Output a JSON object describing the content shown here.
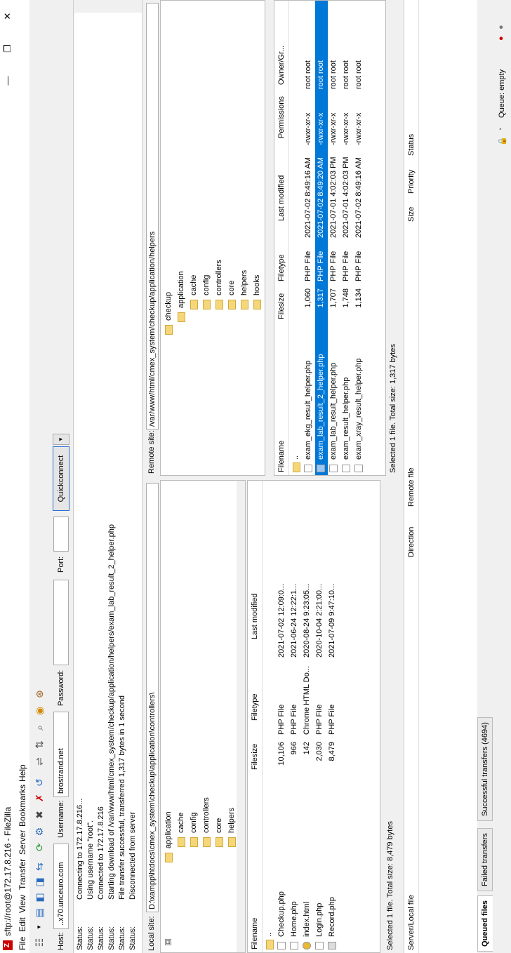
{
  "window": {
    "title": "sftp://root@172.17.8.216 - FileZilla",
    "minimize": "—",
    "maximize": "❐",
    "close": "✕"
  },
  "menu": [
    "File",
    "Edit",
    "View",
    "Transfer",
    "Server",
    "Bookmarks",
    "Help"
  ],
  "quickconnect": {
    "host_label": "Host:",
    "host_value": "..x70.unceuro.com",
    "username_label": "Username:",
    "username_value": "brostrand.net",
    "password_label": "Password:",
    "password_value": "",
    "port_label": "Port:",
    "port_value": "",
    "button": "Quickconnect",
    "dropdown": "▼"
  },
  "log": [
    {
      "k": "Status:",
      "v": "Connecting to 172.17.8.216..."
    },
    {
      "k": "Status:",
      "v": "Using username \"root\"."
    },
    {
      "k": "Status:",
      "v": "Connected to 172.17.8.216"
    },
    {
      "k": "Status:",
      "v": "Starting download of /var/www/html/cmex_system/checkup/application/helpers/exam_lab_result_2_helper.php"
    },
    {
      "k": "Status:",
      "v": "File transfer successful, transferred 1,317 bytes in 1 second"
    },
    {
      "k": "Status:",
      "v": "Disconnected from server"
    }
  ],
  "local": {
    "site_label": "Local site:",
    "path": "D:\\xampp\\htdocs\\cmex_system\\checkup\\application\\controllers\\",
    "tree": [
      "application",
      "cache",
      "config",
      "controllers",
      "core",
      "helpers"
    ],
    "headers": {
      "name": "Filename",
      "size": "Filesize",
      "type": "Filetype",
      "modified": "Last modified"
    },
    "parent": "..",
    "files": [
      {
        "name": "Checkup.php",
        "size": "10,106",
        "type": "PHP File",
        "modified": "2021-07-02 12:09:0..."
      },
      {
        "name": "Home.php",
        "size": "966",
        "type": "PHP File",
        "modified": "2021-06-24 12:22:1..."
      },
      {
        "name": "index.html",
        "size": "142",
        "type": "Chrome HTML Do...",
        "modified": "2020-08-24 9:23:05..."
      },
      {
        "name": "Login.php",
        "size": "2,030",
        "type": "PHP File",
        "modified": "2020-10-04 2:21:00..."
      },
      {
        "name": "Record.php",
        "size": "8,479",
        "type": "PHP File",
        "modified": "2021-07-09 9:47:10..."
      }
    ],
    "status": "Selected 1 file. Total size: 8,479 bytes"
  },
  "remote": {
    "site_label": "Remote site:",
    "path": "/var/www/html/cmex_system/checkup/application/helpers",
    "tree": [
      "checkup",
      "application",
      "cache",
      "config",
      "controllers",
      "core",
      "helpers",
      "hooks"
    ],
    "headers": {
      "name": "Filename",
      "size": "Filesize",
      "type": "Filetype",
      "modified": "Last modified",
      "perms": "Permissions",
      "owner": "Owner/Gr..."
    },
    "parent": "..",
    "files": [
      {
        "name": "exam_ekg_result_helper.php",
        "size": "1,060",
        "type": "PHP File",
        "modified": "2021-07-02 8:49:16 AM",
        "perms": "-rwxr-xr-x",
        "owner": "root root"
      },
      {
        "name": "exam_lab_result_2_helper.php",
        "size": "1,317",
        "type": "PHP File",
        "modified": "2021-07-02 8:49:20 AM",
        "perms": "-rwxr-xr-x",
        "owner": "root root"
      },
      {
        "name": "exam_lab_result_helper.php",
        "size": "1,707",
        "type": "PHP File",
        "modified": "2021-07-01 4:02:03 PM",
        "perms": "-rwxr-xr-x",
        "owner": "root root"
      },
      {
        "name": "exam_result_helper.php",
        "size": "1,748",
        "type": "PHP File",
        "modified": "2021-07-01 4:02:03 PM",
        "perms": "-rwxr-xr-x",
        "owner": "root root"
      },
      {
        "name": "exam_xray_result_helper.php",
        "size": "1,134",
        "type": "PHP File",
        "modified": "2021-07-02 8:49:16 AM",
        "perms": "-rwxr-xr-x",
        "owner": "root root"
      }
    ],
    "selected_index": 1,
    "status": "Selected 1 file. Total size: 1,317 bytes"
  },
  "queue": {
    "headers": {
      "local": "Server/Local file",
      "direction": "Direction",
      "remote": "Remote file",
      "size": "Size",
      "priority": "Priority",
      "status": "Status"
    },
    "tabs": [
      "Queued files",
      "Failed transfers",
      "Successful transfers (4694)"
    ],
    "status": "Queue: empty"
  },
  "colors": {
    "selection": "#0078d7",
    "folder": "#f5d77a",
    "app_icon": "#cc0000"
  }
}
